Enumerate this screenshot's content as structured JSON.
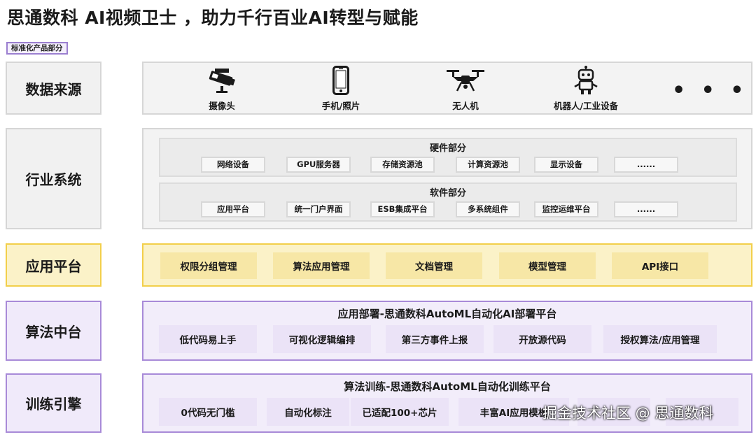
{
  "title": "思通数科 AI视频卫士 ，助力千行百业AI转型与赋能",
  "tag": "标准化产品部分",
  "layers": {
    "data_source": {
      "label": "数据来源",
      "items": [
        {
          "label": "摄像头",
          "icon": "camera-icon"
        },
        {
          "label": "手机/照片",
          "icon": "phone-icon"
        },
        {
          "label": "无人机",
          "icon": "drone-icon"
        },
        {
          "label": "机器人/工业设备",
          "icon": "robot-icon"
        }
      ],
      "more": "• • •"
    },
    "industry": {
      "label": "行业系统",
      "hardware": {
        "title": "硬件部分",
        "items": [
          "网络设备",
          "GPU服务器",
          "存储资源池",
          "计算资源池",
          "显示设备",
          "......"
        ]
      },
      "software": {
        "title": "软件部分",
        "items": [
          "应用平台",
          "统一门户界面",
          "ESB集成平台",
          "多系统组件",
          "监控运维平台",
          "......"
        ]
      }
    },
    "app_platform": {
      "label": "应用平台",
      "items": [
        "权限分组管理",
        "算法应用管理",
        "文档管理",
        "模型管理",
        "API接口"
      ]
    },
    "algo": {
      "label": "算法中台",
      "title": "应用部署-思通数科AutoML自动化AI部署平台",
      "items": [
        "低代码易上手",
        "可视化逻辑编排",
        "第三方事件上报",
        "开放源代码",
        "授权算法/应用管理"
      ]
    },
    "train": {
      "label": "训练引擎",
      "title": "算法训练-思通数科AutoML自动化训练平台",
      "items": [
        "0代码无门槛",
        "自动化标注",
        "已适配100+芯片",
        "丰富AI应用模板",
        ""
      ]
    }
  },
  "watermark": "掘金技术社区 @ 思通数科",
  "colors": {
    "gray_border": "#d6d6d6",
    "yellow_border": "#f2cf4a",
    "yellow_fill": "#fbf2c8",
    "purple_border": "#a88ad8",
    "purple_fill": "#f2edfa"
  }
}
